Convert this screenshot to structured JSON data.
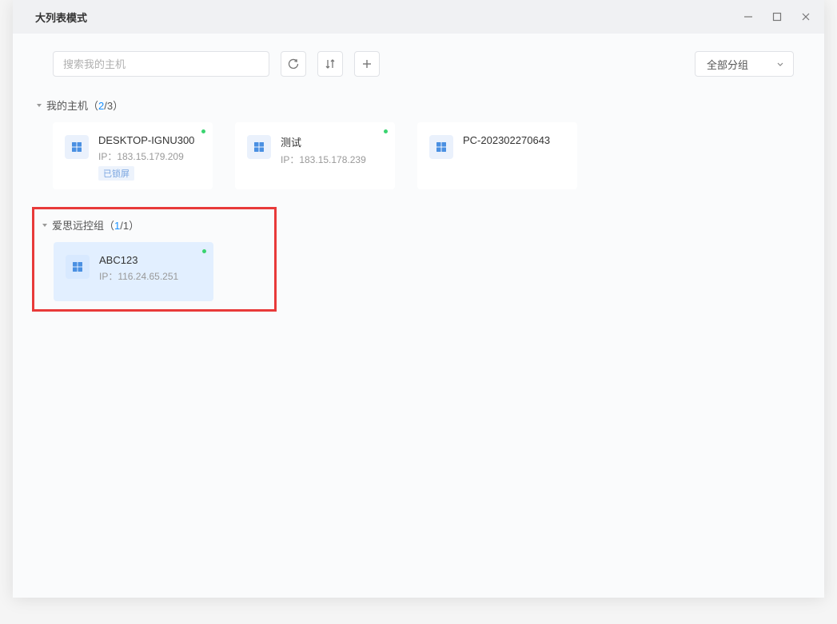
{
  "window": {
    "title": "大列表模式"
  },
  "toolbar": {
    "search_placeholder": "搜索我的主机",
    "group_filter": "全部分组"
  },
  "groups": [
    {
      "name": "我的主机",
      "online": "2",
      "total": "3",
      "highlighted": false,
      "hosts": [
        {
          "name": "DESKTOP-IGNU300",
          "ip_label": "IP：183.15.179.209",
          "badge": "已锁屏",
          "online": true,
          "selected": false
        },
        {
          "name": "测试",
          "ip_label": "IP：183.15.178.239",
          "badge": "",
          "online": true,
          "selected": false
        },
        {
          "name": "PC-202302270643",
          "ip_label": "",
          "badge": "",
          "online": false,
          "selected": false
        }
      ]
    },
    {
      "name": "爱思远控组",
      "online": "1",
      "total": "1",
      "highlighted": true,
      "hosts": [
        {
          "name": "ABC123",
          "ip_label": "IP：116.24.65.251",
          "badge": "",
          "online": true,
          "selected": true
        }
      ]
    }
  ]
}
